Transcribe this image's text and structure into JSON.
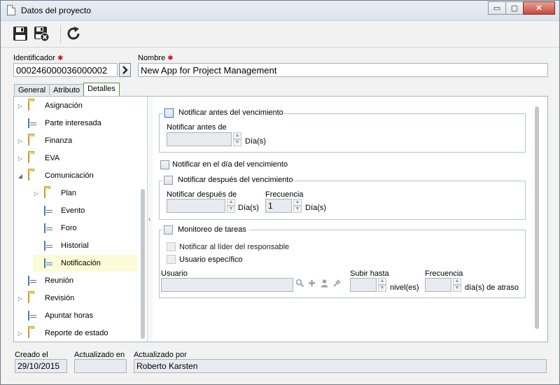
{
  "window": {
    "title": "Datos del proyecto",
    "minimize": "▭",
    "maximize": "▢",
    "close": "✕"
  },
  "toolbar": {
    "save": "save-icon",
    "save_close": "save-close-icon",
    "refresh": "refresh-icon"
  },
  "header": {
    "identificador_label": "Identificador",
    "identificador_value": "000246000036000002",
    "nombre_label": "Nombre",
    "nombre_value": "New App for Project Management",
    "required_mark": "✱"
  },
  "tabs": [
    {
      "label": "General"
    },
    {
      "label": "Atributo"
    },
    {
      "label": "Detalles"
    }
  ],
  "tree": [
    {
      "label": "Asignación",
      "icon": "folder-icon",
      "expand": "▷"
    },
    {
      "label": "Parte interesada",
      "icon": "form-icon",
      "expand": ""
    },
    {
      "label": "Finanza",
      "icon": "folder-icon",
      "expand": "▷"
    },
    {
      "label": "EVA",
      "icon": "folder-icon",
      "expand": "▷"
    },
    {
      "label": "Comunicación",
      "icon": "folder-icon",
      "expand": "◢"
    },
    {
      "label": "Plan",
      "icon": "folder-icon",
      "expand": "▷"
    },
    {
      "label": "Evento",
      "icon": "form-icon",
      "expand": ""
    },
    {
      "label": "Foro",
      "icon": "form-icon",
      "expand": ""
    },
    {
      "label": "Historial",
      "icon": "form-icon",
      "expand": ""
    },
    {
      "label": "Notificación",
      "icon": "form-icon",
      "expand": ""
    },
    {
      "label": "Reunión",
      "icon": "form-icon",
      "expand": ""
    },
    {
      "label": "Revisión",
      "icon": "folder-icon",
      "expand": "▷"
    },
    {
      "label": "Apuntar horas",
      "icon": "form-icon",
      "expand": ""
    },
    {
      "label": "Reporte de estado",
      "icon": "folder-icon",
      "expand": "▷"
    }
  ],
  "splitter_glyph": "‹",
  "details": {
    "antes": {
      "checkbox_label": "Notificar antes del vencimiento",
      "field_label": "Notificar antes de",
      "unit": "Día(s)"
    },
    "en_dia": {
      "checkbox_label": "Notificar en el día del vencimiento"
    },
    "despues": {
      "checkbox_label": "Notificar después del vencimiento",
      "field_label": "Notificar después de",
      "unit": "Día(s)",
      "freq_label": "Frecuencia",
      "freq_value": "1",
      "freq_unit": "Día(s)"
    },
    "monitoreo": {
      "checkbox_label": "Monitoreo de tareas",
      "lider_label": "Notificar al líder del responsable",
      "usuario_especifico_label": "Usuario específico",
      "usuario_label": "Usuario",
      "subir_label": "Subir hasta",
      "subir_unit": "nivel(es)",
      "freq_label": "Frecuencia",
      "freq_unit": "día(s) de atraso"
    },
    "spin_up": "▲",
    "spin_down": "▼"
  },
  "footer": {
    "creado_label": "Creado el",
    "creado_value": "29/10/2015",
    "actualizado_label": "Actualizado en",
    "actualizado_value": "",
    "actualizado_por_label": "Actualizado por",
    "actualizado_por_value": "Roberto Karsten"
  }
}
